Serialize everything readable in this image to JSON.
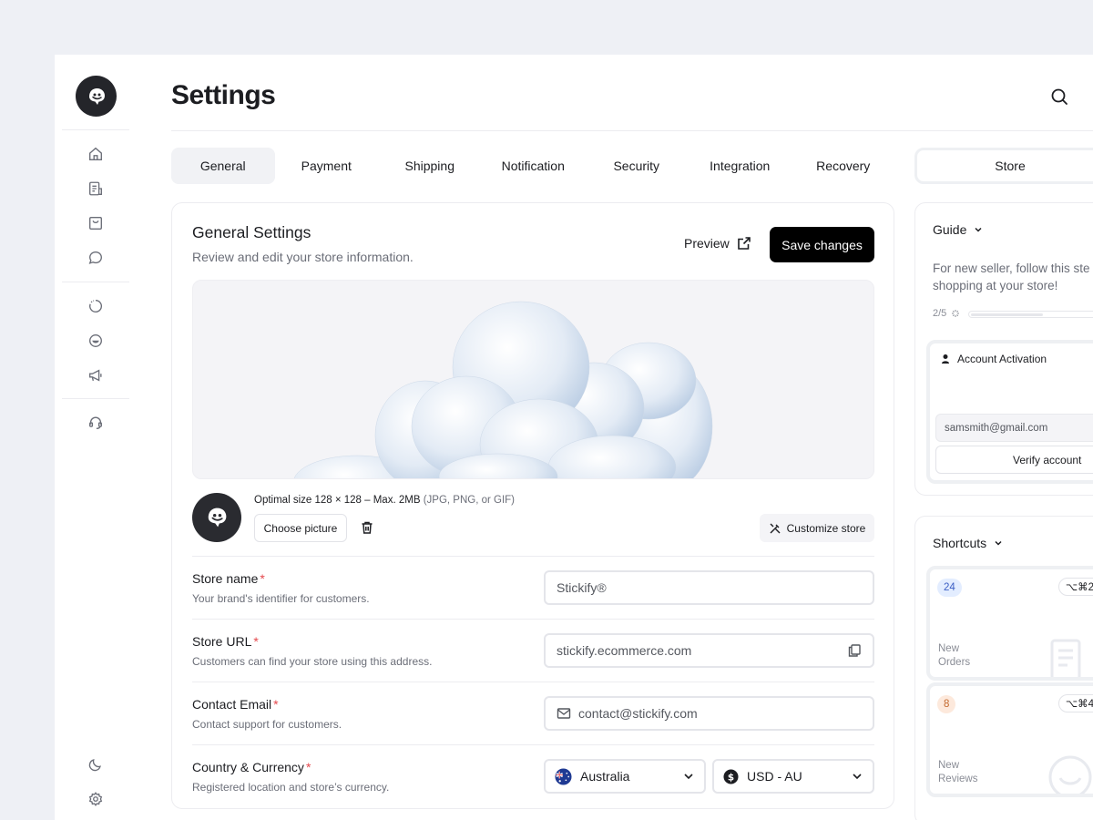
{
  "page": {
    "title": "Settings"
  },
  "tabs": [
    {
      "label": "General",
      "active": true
    },
    {
      "label": "Payment"
    },
    {
      "label": "Shipping"
    },
    {
      "label": "Notification"
    },
    {
      "label": "Security"
    },
    {
      "label": "Integration"
    },
    {
      "label": "Recovery"
    }
  ],
  "right_tab": {
    "label": "Store"
  },
  "sidebar": {
    "icons": [
      "home-icon",
      "orders-icon",
      "shopping-bag-icon",
      "chat-icon",
      "analytics-icon",
      "smile-icon",
      "megaphone-icon",
      "headset-icon",
      "moon-icon",
      "gear-icon"
    ]
  },
  "general": {
    "title": "General Settings",
    "subtitle": "Review and edit your store information.",
    "preview_label": "Preview",
    "save_label": "Save changes",
    "size_hint": "Optimal size 128 × 128 – Max. 2MB",
    "size_formats": "(JPG, PNG, or GIF)",
    "choose_label": "Choose picture",
    "customize_label": "Customize store",
    "fields": {
      "store_name": {
        "label": "Store name",
        "required": "*",
        "desc": "Your brand's identifier for customers.",
        "value": "Stickify®"
      },
      "store_url": {
        "label": "Store URL",
        "required": "*",
        "desc": "Customers can find your store using this address.",
        "value": "stickify.ecommerce.com"
      },
      "contact_email": {
        "label": "Contact Email",
        "required": "*",
        "desc": "Contact support for customers.",
        "value": "contact@stickify.com"
      },
      "country_currency": {
        "label": "Country & Currency",
        "required": "*",
        "desc": "Registered location and store’s currency.",
        "country": "Australia",
        "currency": "USD - AU"
      }
    }
  },
  "guide": {
    "title": "Guide",
    "text_line1": "For new seller, follow this ste",
    "text_line2": "shopping at your store!",
    "progress_label": "2/5",
    "progress_fraction": 0.4,
    "activation_title": "Account Activation",
    "email": "samsmith@gmail.com",
    "verify_label": "Verify account"
  },
  "shortcuts": {
    "title": "Shortcuts",
    "items": [
      {
        "count": "24",
        "key": "⌥⌘2",
        "label_line1": "New",
        "label_line2": "Orders",
        "count_bg": "#e3edff",
        "count_color": "#3d5fc4"
      },
      {
        "count": "8",
        "key": "⌥⌘4",
        "label_line1": "New",
        "label_line2": "Reviews",
        "count_bg": "#fde9dc",
        "count_color": "#c46a2f"
      }
    ]
  },
  "colors": {
    "accent": "#000000",
    "required": "#e5484d",
    "dark": "#24252a"
  }
}
